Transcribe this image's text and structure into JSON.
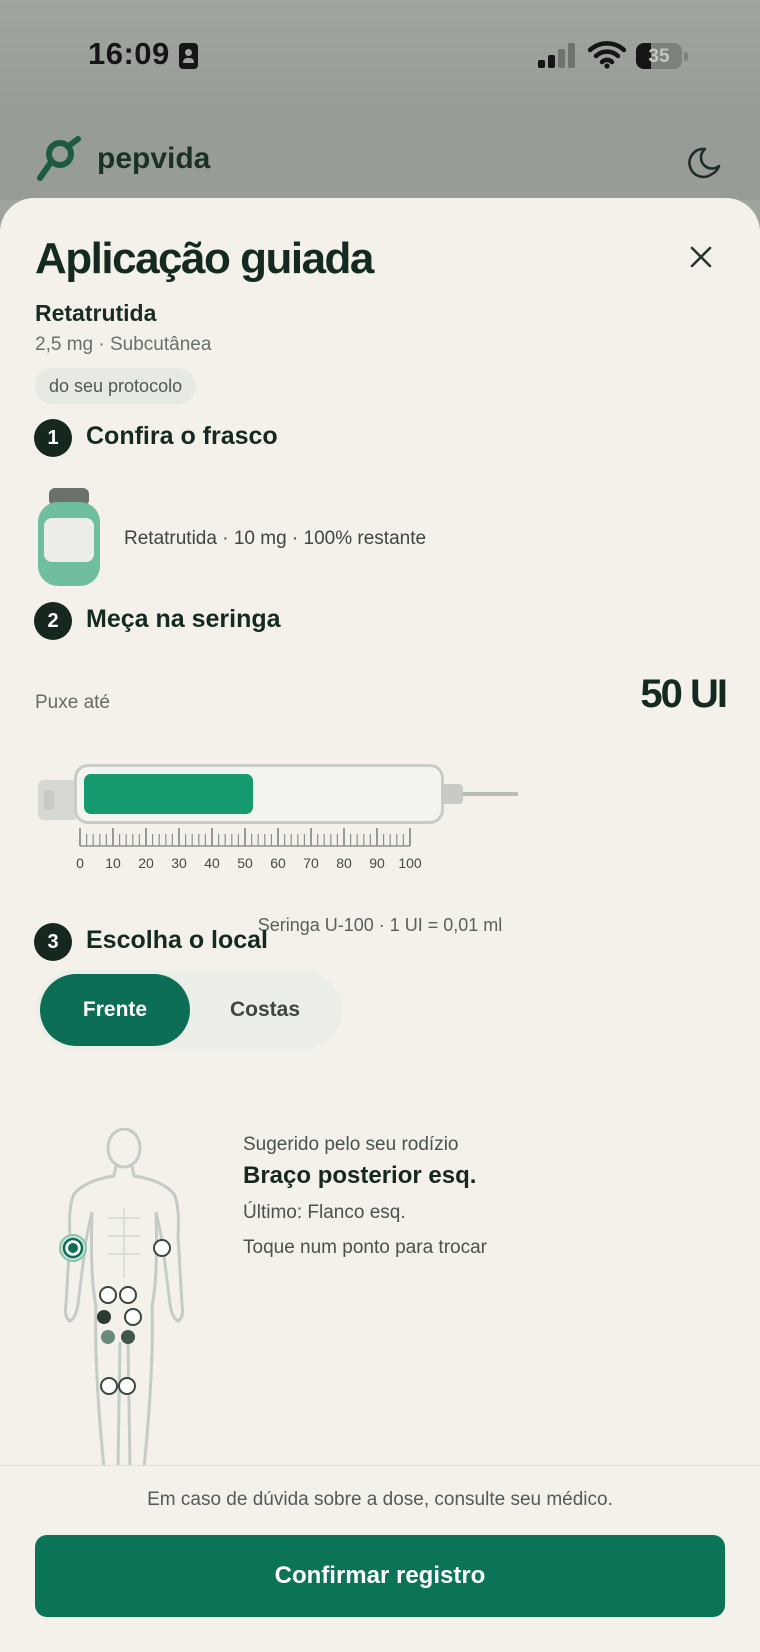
{
  "status_bar": {
    "time": "16:09",
    "battery": "35"
  },
  "app": {
    "brand": "pepvida"
  },
  "sheet": {
    "title": "Aplicação guiada",
    "medication": "Retatrutida",
    "dose_route": "2,5 mg · Subcutânea",
    "protocol_badge": "do seu protocolo"
  },
  "steps": [
    {
      "number": "1",
      "title": "Confira o frasco"
    },
    {
      "number": "2",
      "title": "Meça na seringa"
    },
    {
      "number": "3",
      "title": "Escolha o local"
    }
  ],
  "vial": {
    "info": "Retatrutida · 10 mg · 100% restante"
  },
  "syringe": {
    "pull_label": "Puxe até",
    "pull_value": "50 UI",
    "fill_units": 50,
    "max_units": 100,
    "scale_labels": [
      "0",
      "10",
      "20",
      "30",
      "40",
      "50",
      "60",
      "70",
      "80",
      "90",
      "100"
    ],
    "note": "Seringa U-100 · 1 UI = 0,01 ml"
  },
  "site": {
    "tabs": [
      "Frente",
      "Costas"
    ],
    "active_tab": "Frente",
    "suggested_label": "Sugerido pelo seu rodízio",
    "suggested_site": "Braço posterior esq.",
    "last": "Último: Flanco esq.",
    "hint": "Toque num ponto para trocar"
  },
  "footer": {
    "note": "Em caso de dúvida sobre a dose, consulte seu médico.",
    "confirm_label": "Confirmar registro"
  },
  "colors": {
    "primary": "#0b7457",
    "fill": "#159a6f",
    "background": "#f3f1ea",
    "ink": "#142a21"
  }
}
